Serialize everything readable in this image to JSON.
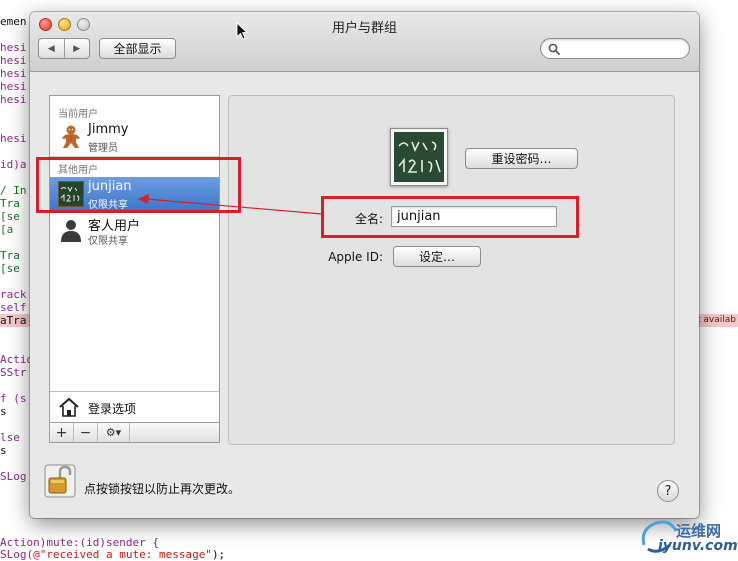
{
  "window": {
    "title": "用户与群组",
    "show_all_label": "全部显示",
    "search_placeholder": ""
  },
  "sidebar": {
    "current_section": "当前用户",
    "other_section": "其他用户",
    "users": [
      {
        "name": "Jimmy",
        "role": "管理员",
        "avatar": "gingerbread-icon"
      },
      {
        "name": "junjian",
        "role": "仅限共享",
        "avatar": "chalkboard-icon",
        "selected": true
      },
      {
        "name": "客人用户",
        "role": "仅限共享",
        "avatar": "person-silhouette-icon"
      }
    ],
    "login_options_label": "登录选项"
  },
  "toolbar": {
    "add": "+",
    "remove": "−",
    "gear": "⚙▾"
  },
  "detail": {
    "reset_password_label": "重设密码…",
    "full_name_label": "全名:",
    "full_name_value": "junjian",
    "apple_id_label": "Apple ID:",
    "apple_id_button": "设定…"
  },
  "footer": {
    "lock_text": "点按锁按钮以防止再次更改。",
    "help_label": "?"
  },
  "background_code": {
    "lines": [
      {
        "t": "emen",
        "c": "tx"
      },
      {
        "t": "hesi",
        "c": "kw"
      },
      {
        "t": "hesi",
        "c": "kw"
      },
      {
        "t": "hesi",
        "c": "kw"
      },
      {
        "t": "hesi",
        "c": "kw"
      },
      {
        "t": "hesi",
        "c": "kw"
      },
      {
        "t": "hesi",
        "c": "kw"
      },
      {
        "t": "id)a",
        "c": "kw"
      },
      {
        "t": "/ In",
        "c": "cm"
      },
      {
        "t": " Tra",
        "c": "cm"
      },
      {
        "t": " [se",
        "c": "cm"
      },
      {
        "t": "  [a",
        "c": "cm"
      },
      {
        "t": " Tra",
        "c": "cm"
      },
      {
        "t": " [se",
        "c": "cm"
      },
      {
        "t": "rack",
        "c": "kw"
      },
      {
        "t": "self",
        "c": "kw"
      },
      {
        "t": "aTra",
        "c": "tx"
      },
      {
        "t": "Actio",
        "c": "kw"
      },
      {
        "t": "SStr",
        "c": "kw"
      },
      {
        "t": "f (s",
        "c": "kw"
      },
      {
        "t": "  s",
        "c": "tx"
      },
      {
        "t": "lse",
        "c": "kw"
      },
      {
        "t": "  s",
        "c": "tx"
      },
      {
        "t": "SLog",
        "c": "kw"
      }
    ],
    "error_note": "t availab",
    "bottom_line_1": "Action)mute:(id)sender {",
    "bottom_line_2_prefix": "SLog(",
    "bottom_line_2_string": "@\"received a mute: message\"",
    "bottom_line_2_suffix": ");"
  },
  "watermark": {
    "top": "运维网",
    "bottom": "iyunv.com"
  },
  "colors": {
    "selection": "#3a73c9",
    "annotation": "#d81e2a",
    "keyword": "#8b2a8c",
    "comment": "#1f6f2a"
  }
}
